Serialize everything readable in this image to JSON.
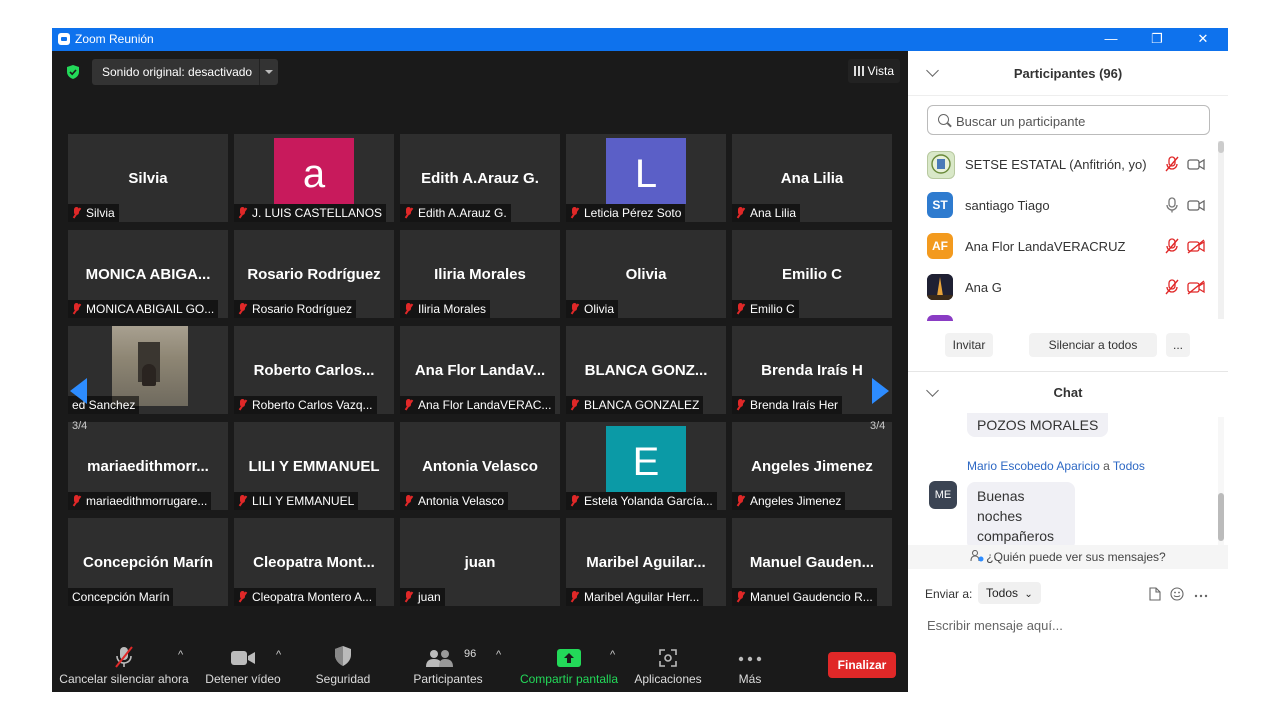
{
  "window": {
    "title": "Zoom Reunión",
    "minimize": "—",
    "restore": "❐",
    "close": "✕"
  },
  "top": {
    "sound_button": "Sonido original: desactivado",
    "view_button": "Vista"
  },
  "pagination": {
    "left": "3/4",
    "right": "3/4"
  },
  "tiles": [
    {
      "big": "Silvia",
      "label": "Silvia",
      "muted": true
    },
    {
      "avatar": "a",
      "avatar_color": "#c81a5c",
      "label": "J. LUIS CASTELLANOS",
      "muted": true
    },
    {
      "big": "Edith A.Arauz G.",
      "label": "Edith A.Arauz G.",
      "muted": true
    },
    {
      "avatar": "L",
      "avatar_color": "#5b5fc7",
      "label": "Leticia Pérez Soto",
      "muted": true
    },
    {
      "big": "Ana Lilia",
      "label": "Ana Lilia",
      "muted": true
    },
    {
      "big": "MONICA ABIGA...",
      "label": "MONICA ABIGAIL GO...",
      "muted": true
    },
    {
      "big": "Rosario Rodríguez",
      "label": "Rosario Rodríguez",
      "muted": true
    },
    {
      "big": "Iliria Morales",
      "label": "Iliria Morales",
      "muted": true
    },
    {
      "big": "Olivia",
      "label": "Olivia",
      "muted": true
    },
    {
      "big": "Emilio C",
      "label": "Emilio C",
      "muted": true
    },
    {
      "photo": true,
      "label": "ed Sanchez",
      "muted": false
    },
    {
      "big": "Roberto Carlos...",
      "label": "Roberto Carlos Vazq...",
      "muted": true
    },
    {
      "big": "Ana Flor LandaV...",
      "label": "Ana Flor LandaVERAC...",
      "muted": true
    },
    {
      "big": "BLANCA GONZ...",
      "label": "BLANCA GONZALEZ",
      "muted": true
    },
    {
      "big": "Brenda Iraís H",
      "label": "Brenda Iraís Her",
      "muted": true
    },
    {
      "big": "mariaedithmorr...",
      "label": "mariaedithmorrugare...",
      "muted": true
    },
    {
      "big": "LILI Y EMMANUEL",
      "label": "LILI Y EMMANUEL",
      "muted": true
    },
    {
      "big": "Antonia Velasco",
      "label": "Antonia Velasco",
      "muted": true
    },
    {
      "avatar": "E",
      "avatar_color": "#0b9aa6",
      "label": "Estela Yolanda García...",
      "muted": true
    },
    {
      "big": "Angeles Jimenez",
      "label": "Angeles Jimenez",
      "muted": true
    },
    {
      "big": "Concepción Marín",
      "label": "Concepción Marín",
      "muted": false
    },
    {
      "big": "Cleopatra Mont...",
      "label": "Cleopatra Montero A...",
      "muted": true
    },
    {
      "big": "juan",
      "label": "juan",
      "muted": true
    },
    {
      "big": "Maribel Aguilar...",
      "label": "Maribel Aguilar Herr...",
      "muted": true
    },
    {
      "big": "Manuel Gauden...",
      "label": "Manuel Gaudencio R...",
      "muted": true
    }
  ],
  "toolbar": {
    "unmute": "Cancelar silenciar ahora",
    "stop_video": "Detener vídeo",
    "security": "Seguridad",
    "participants": "Participantes",
    "participants_count": "96",
    "share": "Compartir pantalla",
    "apps": "Aplicaciones",
    "more": "Más",
    "end": "Finalizar"
  },
  "participants_panel": {
    "title": "Participantes (96)",
    "search_placeholder": "Buscar un participante",
    "items": [
      {
        "initials": "",
        "name": "SETSE ESTATAL (Anfitrión, yo)",
        "color": "#d9e8c8"
      },
      {
        "initials": "ST",
        "name": "santiago Tiago",
        "color": "#2e7bcf"
      },
      {
        "initials": "AF",
        "name": "Ana Flor LandaVERACRUZ",
        "color": "#f39a1e"
      },
      {
        "initials": "",
        "name": "Ana G",
        "color": "#2a2a44"
      }
    ],
    "invite": "Invitar",
    "mute_all": "Silenciar a todos",
    "more": "..."
  },
  "chat": {
    "title": "Chat",
    "prev_message": "POZOS MORALES",
    "sender": "Mario Escobedo Aparicio",
    "to_word": "a",
    "recipient": "Todos",
    "avatar": "ME",
    "message": "Buenas noches compañeros",
    "who_can_see": "¿Quién puede ver sus mensajes?",
    "send_to_label": "Enviar a:",
    "send_to_value": "Todos",
    "input_placeholder": "Escribir mensaje aquí..."
  },
  "colors": {
    "accent": "#0e72ed",
    "end": "#e02828",
    "share": "#23d959",
    "muted_mic": "#e02828"
  }
}
